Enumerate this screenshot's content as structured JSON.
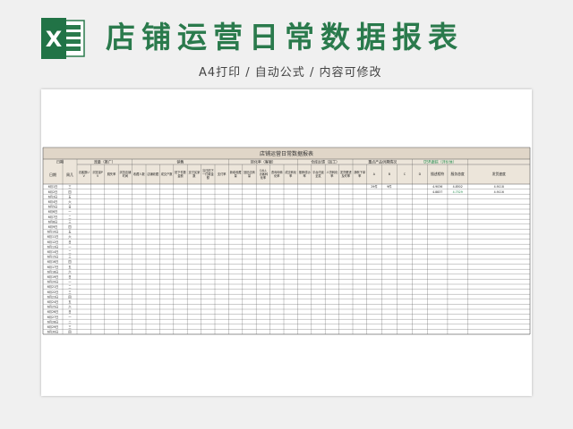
{
  "header": {
    "app_icon": "excel-icon",
    "logo_letter": "X",
    "title": "店铺运营日常数据报表",
    "subtitle": "A4打印 / 自动公式 / 内容可修改"
  },
  "sheet": {
    "table_title": "店铺运营日常数据报表",
    "date_group": "日期",
    "date_col": "日期",
    "weekday_col": "周几",
    "groups": [
      "流量（推广）",
      "销售",
      "转化率（客服）",
      "仓库反馈（加工）",
      "重点产品供需情况",
      "DSR跟踪（评价体）"
    ],
    "subheaders": [
      "访客数UV",
      "浏览量PV",
      "跳失率",
      "浏览店铺时间",
      "收藏人数",
      "店铺收藏",
      "成交户数",
      "拍下件数金额",
      "支付买家数",
      "当日拍下一付款金额",
      "支付率",
      "新增收藏量",
      "回旧店商量",
      "CALL 访客转化率",
      "咨询询转化率",
      "成交转化率",
      "推荐成功率",
      "平台内延迟发",
      "人货转化率",
      "发货跟进及时率",
      "静默下单率",
      "A",
      "B",
      "C",
      "D",
      "描述相符",
      "服务态度",
      "发货速度"
    ],
    "sample": {
      "a1": "29件",
      "b1": "9件",
      "dsr_r1": [
        "4.9036",
        "4.8502",
        "4.9118"
      ],
      "dsr_r2": [
        "4.8837",
        "4.7529",
        "4.9116"
      ]
    },
    "dates": [
      "6月1日",
      "6月2日",
      "6月3日",
      "6月4日",
      "6月5日",
      "6月6日",
      "6月7日",
      "6月8日",
      "6月9日",
      "6月10日",
      "6月11日",
      "6月12日",
      "6月13日",
      "6月14日",
      "6月15日",
      "6月16日",
      "6月17日",
      "6月18日",
      "6月19日",
      "6月20日",
      "6月21日",
      "6月22日",
      "6月23日",
      "6月24日",
      "6月25日",
      "6月26日",
      "6月27日",
      "6月28日",
      "6月29日",
      "6月30日"
    ],
    "weekdays": [
      "三",
      "四",
      "五",
      "六",
      "日",
      "一",
      "二",
      "三",
      "四",
      "五",
      "六",
      "日",
      "一",
      "二",
      "三",
      "四",
      "五",
      "六",
      "日",
      "一",
      "二",
      "三",
      "四",
      "五",
      "六",
      "日",
      "一",
      "二",
      "三",
      "四"
    ]
  },
  "colors": {
    "brand_green": "#2a7a4c",
    "title_band": "#e0d6c8",
    "header_band": "#ece5da",
    "dsr_green": "#1e8a4a"
  }
}
